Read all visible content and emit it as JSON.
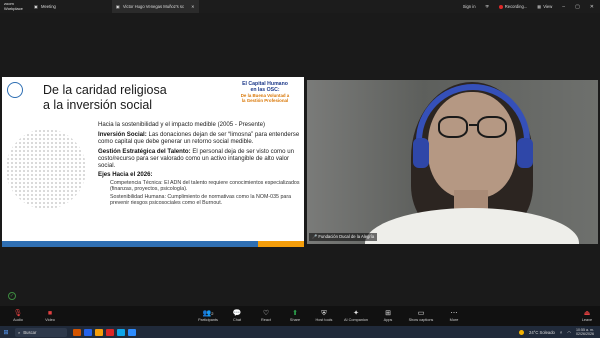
{
  "titlebar": {
    "logo_line1": "zoom",
    "logo_line2": "Workplace",
    "tab_meeting": "Meeting",
    "tab_share": "Victor Hugo Venegas Muñoz's sc",
    "signin": "Sign in",
    "recording": "Recording...",
    "view": "View"
  },
  "slide": {
    "title_line1": "De la caridad religiosa",
    "title_line2": "a la inversión social",
    "badge_line1": "El Capital Humano",
    "badge_line2": "en las OSC:",
    "badge_line3": "De la Buena Voluntad a",
    "badge_line4": "la Gestión Profesional",
    "intro": "Hacia la sostenibilidad y el impacto medible (2005 - Presente)",
    "p1_head": "Inversión Social:",
    "p1_text": " Las donaciones dejan de ser “limosna” para entenderse como capital que debe generar un retorno social medible.",
    "p2_head": "Gestión Estratégica del Talento:",
    "p2_text": " El personal deja de ser visto como un costo/recurso para ser valorado como un activo intangible de alto valor social.",
    "p3_head": "Ejes Hacia el 2026:",
    "sub1": "Competencia Técnica: El ADN del talento requiere conocimientos especializados (finanzas, proyectos, psicología).",
    "sub2": "Sostenibilidad Humana: Cumplimiento de normativas como la NOM-035 para prevenir riesgos psicosociales como el Burnout."
  },
  "video": {
    "name": "Fundación Ducal de la Alegría"
  },
  "toolbar": {
    "audio": "Audio",
    "video": "Video",
    "participants": "Participants",
    "participants_count": "2",
    "chat": "Chat",
    "react": "React",
    "share": "Share",
    "host_tools": "Host tools",
    "ai_companion": "AI Companion",
    "apps": "Apps",
    "show_captions": "Show captions",
    "more": "More",
    "leave": "Leave"
  },
  "taskbar": {
    "search_placeholder": "Buscar",
    "weather": "24°C  Soleado",
    "time": "10:55 a. m.",
    "date": "02/26/2026"
  },
  "colors": {
    "slide_accent": "#2f6fb3",
    "badge_orange": "#d97706",
    "record_red": "#e02828",
    "share_green": "#2da44e"
  }
}
